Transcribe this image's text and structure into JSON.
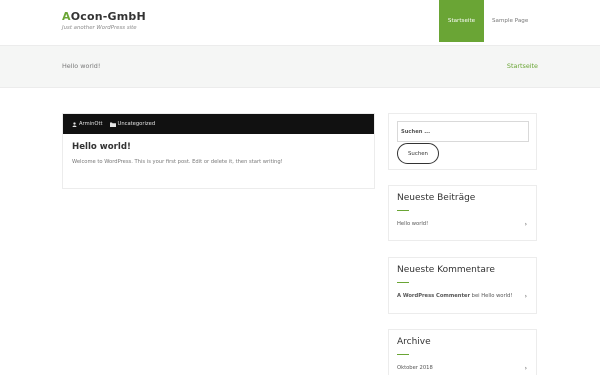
{
  "site": {
    "title_first": "A",
    "title_rest": "Ocon-GmbH",
    "tagline": "Just another WordPress site"
  },
  "nav": [
    {
      "label": "Startseite",
      "active": true
    },
    {
      "label": "Sample Page",
      "active": false
    }
  ],
  "band": {
    "title": "Hello world!",
    "breadcrumb": "Startseite"
  },
  "post": {
    "author": "ArminOtt",
    "category": "Uncategorized",
    "title": "Hello world!",
    "excerpt": "Welcome to WordPress. This is your first post. Edit or delete it, then start writing!"
  },
  "sidebar": {
    "search": {
      "placeholder": "Suchen ...",
      "button": "Suchen"
    },
    "recent_posts": {
      "title": "Neueste Beiträge",
      "items": [
        "Hello world!"
      ]
    },
    "recent_comments": {
      "title": "Neueste Kommentare",
      "author": "A WordPress Commenter",
      "connector": "bei",
      "post": "Hello world!"
    },
    "archive": {
      "title": "Archive",
      "items": [
        "Oktober 2018"
      ]
    }
  },
  "colors": {
    "accent": "#6aa535",
    "meta_bar": "#111111"
  },
  "icons": {
    "chevron": "›",
    "user": "user-icon",
    "folder": "folder-icon"
  }
}
